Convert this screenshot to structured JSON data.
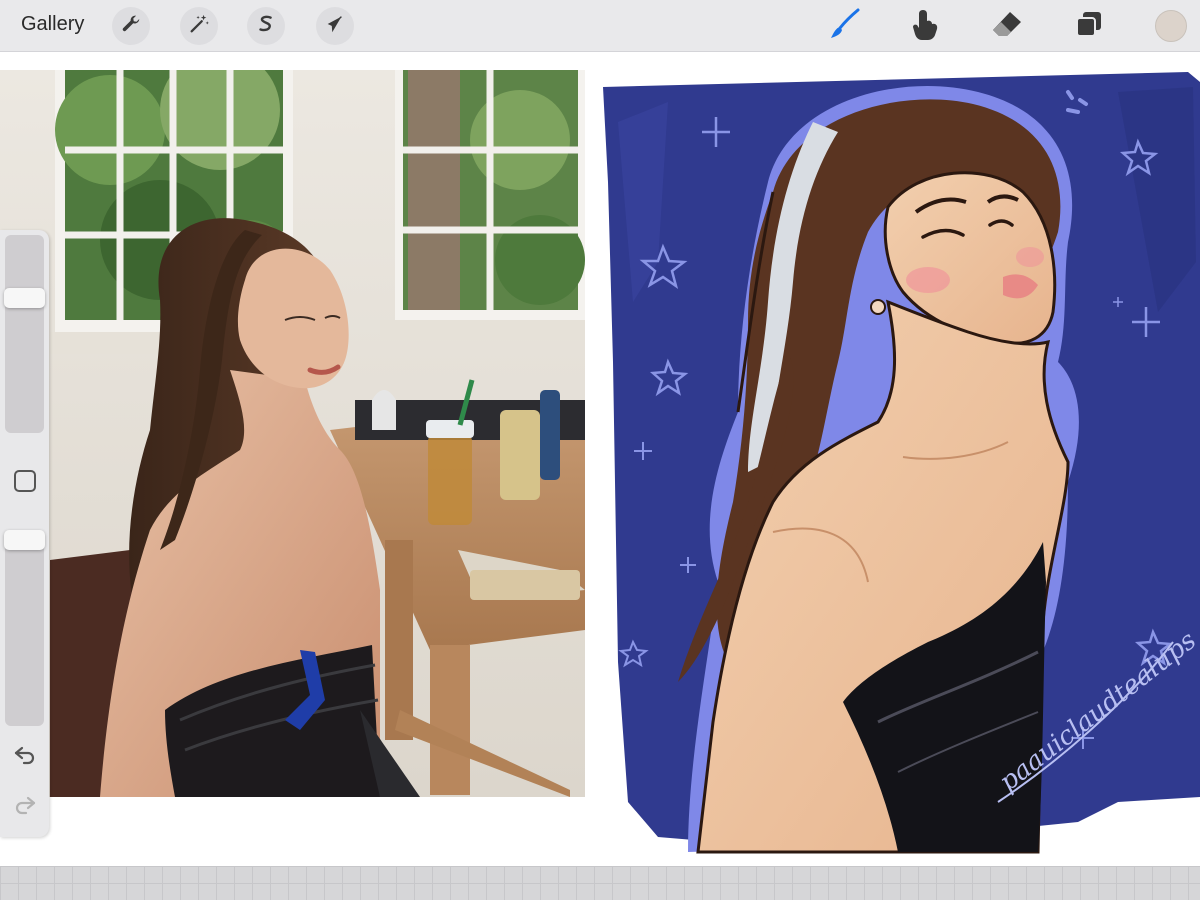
{
  "toolbar": {
    "gallery_label": "Gallery",
    "actions": [
      {
        "name": "actions",
        "icon": "wrench-icon"
      },
      {
        "name": "adjustments",
        "icon": "magic-wand-icon"
      },
      {
        "name": "selection",
        "icon": "selection-s-icon"
      },
      {
        "name": "transform",
        "icon": "arrow-cursor-icon"
      }
    ],
    "tools": [
      {
        "name": "brush",
        "icon": "brush-icon",
        "active": true
      },
      {
        "name": "smudge",
        "icon": "smudge-finger-icon",
        "active": false
      },
      {
        "name": "eraser",
        "icon": "eraser-icon",
        "active": false
      },
      {
        "name": "layers",
        "icon": "layers-icon",
        "active": false
      }
    ],
    "active_color": "#dcd3cb",
    "active_tool_color": "#1a73e8"
  },
  "sidebar": {
    "brush_size_level": 0.7,
    "opacity_level": 1.0,
    "modify_icon": "square-icon",
    "undo_icon": "undo-arrow-icon",
    "redo_icon": "redo-arrow-icon"
  },
  "canvas": {
    "signature_text": "paauiclaudtealups",
    "background_color": "#303a8f"
  }
}
